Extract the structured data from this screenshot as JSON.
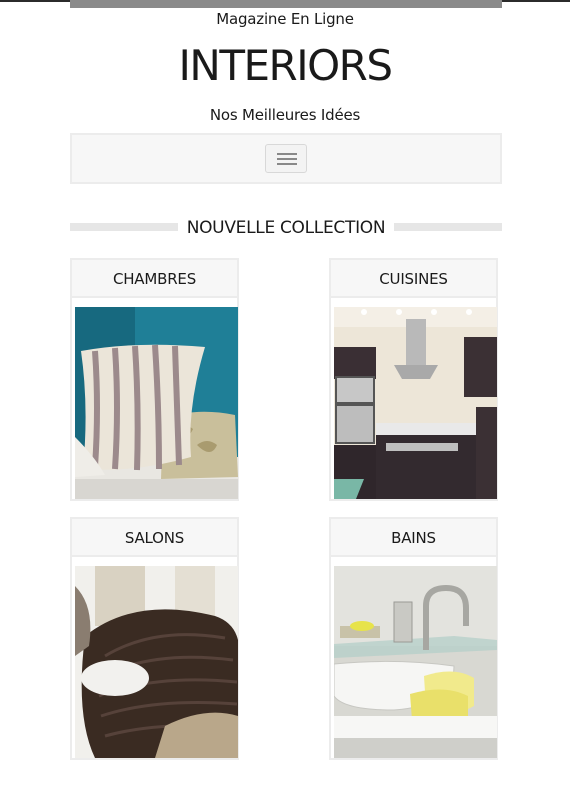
{
  "header": {
    "tagline": "Magazine En Ligne",
    "site_title": "INTERIORS",
    "subtitle": "Nos Meilleures Idées"
  },
  "navbar": {
    "toggle_icon": "hamburger-icon"
  },
  "section": {
    "heading": "NOUVELLE COLLECTION"
  },
  "categories": [
    {
      "label": "CHAMBRES"
    },
    {
      "label": "CUISINES"
    },
    {
      "label": "SALONS"
    },
    {
      "label": "BAINS"
    }
  ],
  "colors": {
    "panel_bg": "#f7f7f7",
    "panel_border": "#ececec",
    "top_bar": "#8a8a8a",
    "text": "#1a1a1a"
  }
}
